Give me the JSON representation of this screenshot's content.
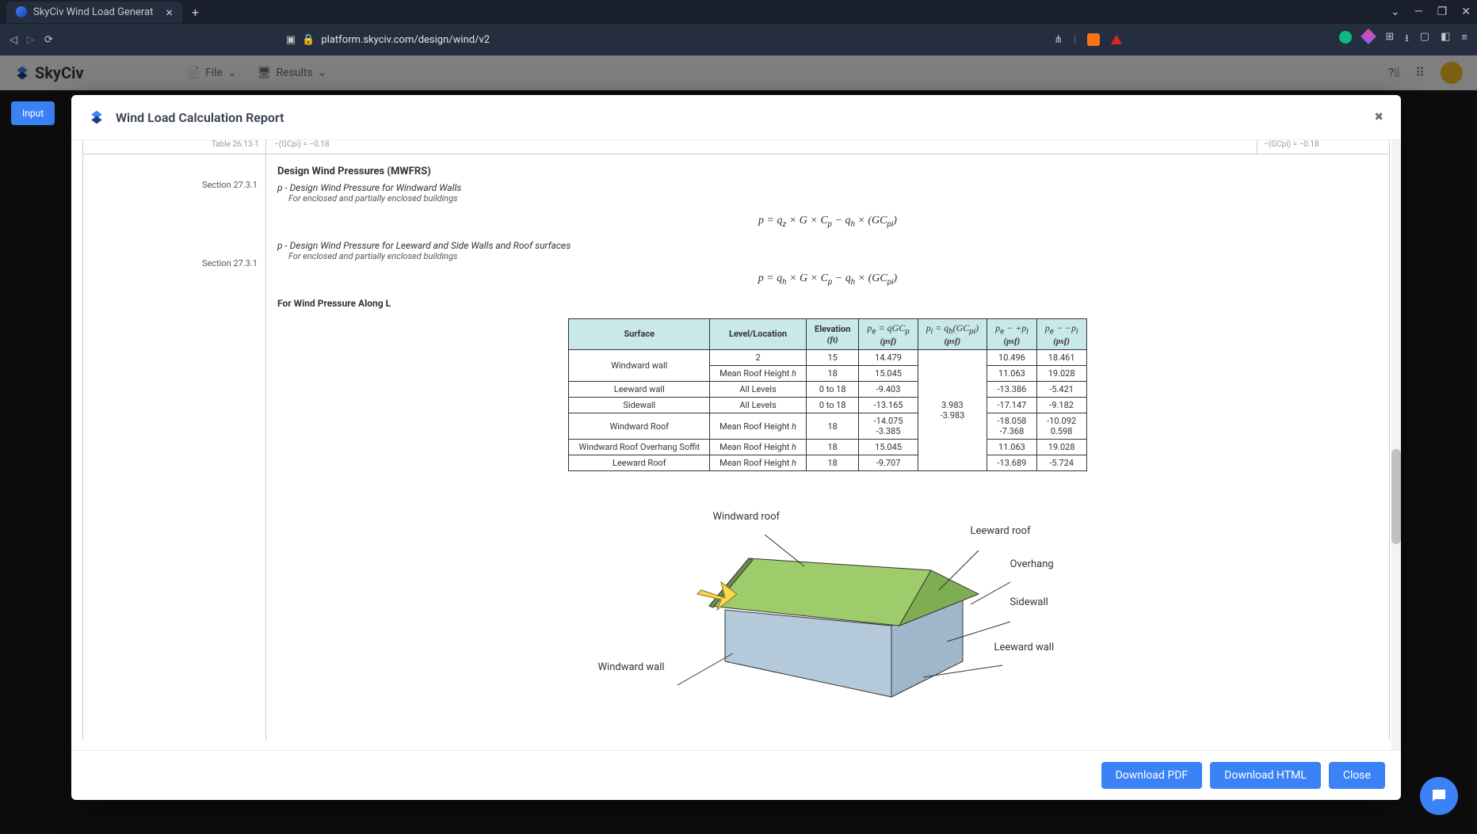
{
  "browser": {
    "tab_title": "SkyCiv Wind Load Generat",
    "url": "platform.skyciv.com/design/wind/v2"
  },
  "app": {
    "brand": "SkyCiv",
    "menu": {
      "file": "File",
      "results": "Results"
    },
    "input_btn": "Input"
  },
  "modal": {
    "title": "Wind Load Calculation Report",
    "buttons": {
      "pdf": "Download PDF",
      "html": "Download HTML",
      "close": "Close"
    }
  },
  "report": {
    "top_fragment": {
      "left": "Table 26.13-1",
      "mid": "−(GCpi) = −0.18",
      "right": "−(GCpi) = −0.18"
    },
    "heading_mwfrs": "Design Wind Pressures (MWFRS)",
    "sec1_ref": "Section 27.3.1",
    "sec1_title": "p - Design Wind Pressure for Windward Walls",
    "sec1_note": "For enclosed and partially enclosed buildings",
    "sec1_formula": "p = qz × G × Cp − qh × (GCpi)",
    "sec2_ref": "Section 27.3.1",
    "sec2_title": "p - Design Wind Pressure for Leeward and Side Walls and Roof surfaces",
    "sec2_note": "For enclosed and partially enclosed buildings",
    "sec2_formula": "p = qh × G × Cp − qh × (GCpi)",
    "pressure_along_L": "For Wind Pressure Along L",
    "table": {
      "headers": {
        "surface": "Surface",
        "level": "Level/Location",
        "elevation": "Elevation",
        "elevation_unit": "(ft)",
        "pe": "pe = qGCp",
        "pi": "pi = qh(GCpi)",
        "pe_plus": "pe − +pi",
        "pe_minus": "pe − −pi",
        "psf": "(psf)"
      },
      "rows": [
        {
          "surface_rowspan": "Windward wall",
          "level": "2",
          "elev": "15",
          "pe": "14.479",
          "pi": "",
          "pep": "10.496",
          "pem": "18.461"
        },
        {
          "level": "Mean Roof Height h",
          "elev": "18",
          "pe": "15.045",
          "pi": "",
          "pep": "11.063",
          "pem": "19.028"
        },
        {
          "surface": "Leeward wall",
          "level": "All Levels",
          "elev": "0 to 18",
          "pe": "-9.403",
          "pi_mid": "3.983\n-3.983",
          "pep": "-13.386",
          "pem": "-5.421"
        },
        {
          "surface": "Sidewall",
          "level": "All Levels",
          "elev": "0 to 18",
          "pe": "-13.165",
          "pep": "-17.147",
          "pem": "-9.182"
        },
        {
          "surface": "Windward Roof",
          "level": "Mean Roof Height h",
          "elev": "18",
          "pe": "-14.075\n-3.385",
          "pep": "-18.058\n-7.368",
          "pem": "-10.092\n0.598"
        },
        {
          "surface": "Windward Roof Overhang Soffit",
          "level": "Mean Roof Height h",
          "elev": "18",
          "pe": "15.045",
          "pep": "11.063",
          "pem": "19.028"
        },
        {
          "surface": "Leeward Roof",
          "level": "Mean Roof Height h",
          "elev": "18",
          "pe": "-9.707",
          "pep": "-13.689",
          "pem": "-5.724"
        }
      ]
    },
    "diagram_labels": {
      "windward_roof": "Windward roof",
      "leeward_roof": "Leeward roof",
      "overhang": "Overhang",
      "sidewall": "Sidewall",
      "leeward_wall": "Leeward wall",
      "windward_wall": "Windward wall"
    }
  }
}
